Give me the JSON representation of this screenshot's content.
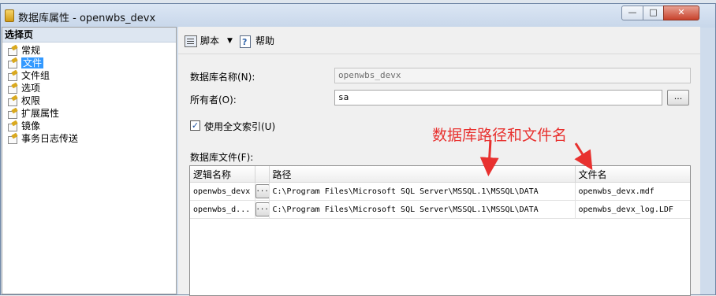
{
  "window": {
    "title": "数据库属性 - openwbs_devx"
  },
  "left_panel": {
    "header": "选择页",
    "items": [
      {
        "label": "常规",
        "selected": false
      },
      {
        "label": "文件",
        "selected": true
      },
      {
        "label": "文件组",
        "selected": false
      },
      {
        "label": "选项",
        "selected": false
      },
      {
        "label": "权限",
        "selected": false
      },
      {
        "label": "扩展属性",
        "selected": false
      },
      {
        "label": "镜像",
        "selected": false
      },
      {
        "label": "事务日志传送",
        "selected": false
      }
    ]
  },
  "toolbar": {
    "script_label": "脚本",
    "help_label": "帮助"
  },
  "form": {
    "db_name_label": "数据库名称(N):",
    "db_name_value": "openwbs_devx",
    "owner_label": "所有者(O):",
    "owner_value": "sa",
    "browse_label": "...",
    "fulltext_label": "使用全文索引(U)",
    "fulltext_checked": true,
    "db_files_label": "数据库文件(F):"
  },
  "grid": {
    "columns": [
      "逻辑名称",
      "路径",
      "文件名"
    ],
    "rows": [
      {
        "logical": "openwbs_devx",
        "path": "C:\\Program Files\\Microsoft SQL Server\\MSSQL.1\\MSSQL\\DATA",
        "filename": "openwbs_devx.mdf"
      },
      {
        "logical": "openwbs_d...",
        "path": "C:\\Program Files\\Microsoft SQL Server\\MSSQL.1\\MSSQL\\DATA",
        "filename": "openwbs_devx_log.LDF"
      }
    ],
    "cell_button_label": "..."
  },
  "annotation": {
    "text": "数据库路径和文件名",
    "color": "#e8312f"
  },
  "colors": {
    "selection": "#3399ff",
    "close_button": "#c8422c"
  }
}
